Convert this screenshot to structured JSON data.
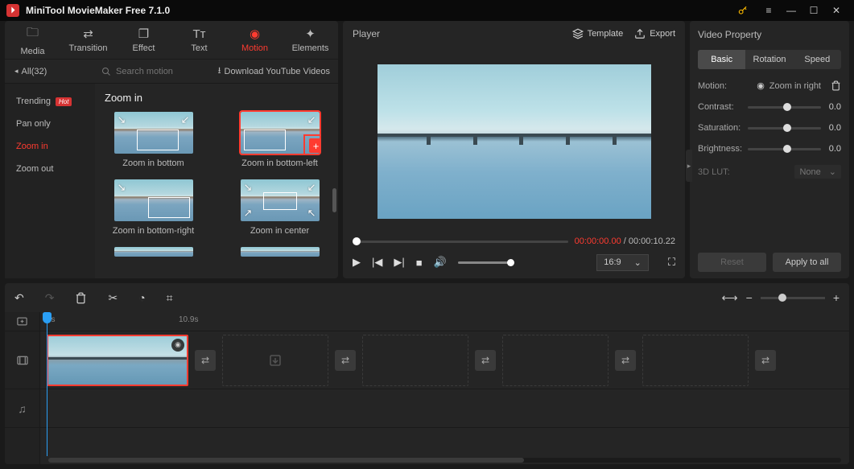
{
  "app": {
    "title": "MiniTool MovieMaker Free 7.1.0"
  },
  "topTabs": [
    {
      "label": "Media",
      "icon": "🗀"
    },
    {
      "label": "Transition",
      "icon": "⇄"
    },
    {
      "label": "Effect",
      "icon": "❐"
    },
    {
      "label": "Text",
      "icon": "Tᴛ"
    },
    {
      "label": "Motion",
      "icon": "◉",
      "active": true
    },
    {
      "label": "Elements",
      "icon": "✦"
    }
  ],
  "library": {
    "allLabel": "All(32)",
    "searchPlaceholder": "Search motion",
    "download": "Download YouTube Videos",
    "categories": [
      {
        "label": "Trending",
        "hot": true
      },
      {
        "label": "Pan only"
      },
      {
        "label": "Zoom in",
        "active": true
      },
      {
        "label": "Zoom out"
      }
    ],
    "sectionTitle": "Zoom in",
    "items": [
      {
        "label": "Zoom in bottom"
      },
      {
        "label": "Zoom in bottom-left",
        "selected": true,
        "highlight": true
      },
      {
        "label": "Zoom in bottom-right"
      },
      {
        "label": "Zoom in center"
      }
    ]
  },
  "player": {
    "title": "Player",
    "template": "Template",
    "export": "Export",
    "time_current": "00:00:00.00",
    "time_total": "00:00:10.22",
    "aspect": "16:9"
  },
  "props": {
    "title": "Video Property",
    "tabs": [
      "Basic",
      "Rotation",
      "Speed"
    ],
    "motionLabel": "Motion:",
    "motionValue": "Zoom in right",
    "rows": [
      {
        "label": "Contrast:",
        "value": "0.0"
      },
      {
        "label": "Saturation:",
        "value": "0.0"
      },
      {
        "label": "Brightness:",
        "value": "0.0"
      }
    ],
    "lutLabel": "3D LUT:",
    "lutValue": "None",
    "reset": "Reset",
    "apply": "Apply to all"
  },
  "timeline": {
    "ruler": {
      "start": "0s",
      "mark": "10.9s"
    }
  }
}
